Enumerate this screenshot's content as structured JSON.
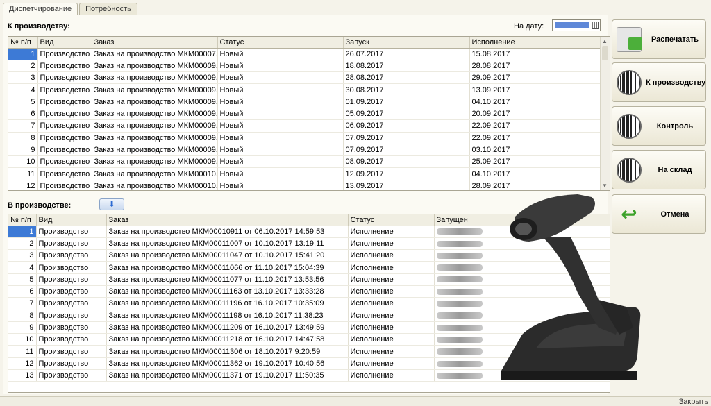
{
  "tabs": [
    {
      "label": "Диспетчирование",
      "active": true
    },
    {
      "label": "Потребность",
      "active": false
    }
  ],
  "top_section": {
    "title": "К производству:",
    "date_label": "На дату:",
    "columns": [
      "№ п/п",
      "Вид",
      "Заказ",
      "Статус",
      "Запуск",
      "Исполнение"
    ],
    "rows": [
      [
        "1",
        "Производство",
        "Заказ на производство МКМ00007...",
        "Новый",
        "26.07.2017",
        "15.08.2017"
      ],
      [
        "2",
        "Производство",
        "Заказ на производство МКМ00009...",
        "Новый",
        "18.08.2017",
        "28.08.2017"
      ],
      [
        "3",
        "Производство",
        "Заказ на производство МКМ00009...",
        "Новый",
        "28.08.2017",
        "29.09.2017"
      ],
      [
        "4",
        "Производство",
        "Заказ на производство МКМ00009...",
        "Новый",
        "30.08.2017",
        "13.09.2017"
      ],
      [
        "5",
        "Производство",
        "Заказ на производство МКМ00009...",
        "Новый",
        "01.09.2017",
        "04.10.2017"
      ],
      [
        "6",
        "Производство",
        "Заказ на производство МКМ00009...",
        "Новый",
        "05.09.2017",
        "20.09.2017"
      ],
      [
        "7",
        "Производство",
        "Заказ на производство МКМ00009...",
        "Новый",
        "06.09.2017",
        "22.09.2017"
      ],
      [
        "8",
        "Производство",
        "Заказ на производство МКМ00009...",
        "Новый",
        "07.09.2017",
        "22.09.2017"
      ],
      [
        "9",
        "Производство",
        "Заказ на производство МКМ00009...",
        "Новый",
        "07.09.2017",
        "03.10.2017"
      ],
      [
        "10",
        "Производство",
        "Заказ на производство МКМ00009...",
        "Новый",
        "08.09.2017",
        "25.09.2017"
      ],
      [
        "11",
        "Производство",
        "Заказ на производство МКМ00010...",
        "Новый",
        "12.09.2017",
        "04.10.2017"
      ],
      [
        "12",
        "Производство",
        "Заказ на производство МКМ00010...",
        "Новый",
        "13.09.2017",
        "28.09.2017"
      ]
    ]
  },
  "bottom_section": {
    "title": "В производстве:",
    "columns": [
      "№ п/п",
      "Вид",
      "Заказ",
      "Статус",
      "Запущен"
    ],
    "rows": [
      [
        "1",
        "Производство",
        "Заказ на производство МКМ00010911 от 06.10.2017 14:59:53",
        "Исполнение"
      ],
      [
        "2",
        "Производство",
        "Заказ на производство МКМ00011007 от 10.10.2017 13:19:11",
        "Исполнение"
      ],
      [
        "3",
        "Производство",
        "Заказ на производство МКМ00011047 от 10.10.2017 15:41:20",
        "Исполнение"
      ],
      [
        "4",
        "Производство",
        "Заказ на производство МКМ00011066 от 11.10.2017 15:04:39",
        "Исполнение"
      ],
      [
        "5",
        "Производство",
        "Заказ на производство МКМ00011077 от 11.10.2017 13:53:56",
        "Исполнение"
      ],
      [
        "6",
        "Производство",
        "Заказ на производство МКМ00011163 от 13.10.2017 13:33:28",
        "Исполнение"
      ],
      [
        "7",
        "Производство",
        "Заказ на производство МКМ00011196 от 16.10.2017 10:35:09",
        "Исполнение"
      ],
      [
        "8",
        "Производство",
        "Заказ на производство МКМ00011198 от 16.10.2017 11:38:23",
        "Исполнение"
      ],
      [
        "9",
        "Производство",
        "Заказ на производство МКМ00011209 от 16.10.2017 13:49:59",
        "Исполнение"
      ],
      [
        "10",
        "Производство",
        "Заказ на производство МКМ00011218 от 16.10.2017 14:47:58",
        "Исполнение"
      ],
      [
        "11",
        "Производство",
        "Заказ на производство МКМ00011306 от 18.10.2017 9:20:59",
        "Исполнение"
      ],
      [
        "12",
        "Производство",
        "Заказ на производство МКМ00011362 от 19.10.2017 10:40:56",
        "Исполнение"
      ],
      [
        "13",
        "Производство",
        "Заказ на производство МКМ00011371 от 19.10.2017 11:50:35",
        "Исполнение"
      ]
    ]
  },
  "buttons": {
    "print": "Распечатать",
    "to_production": "К производству",
    "control": "Контроль",
    "to_warehouse": "На склад",
    "cancel": "Отмена"
  },
  "status_bar": {
    "close": "Закрыть"
  },
  "colors": {
    "selection": "#3d7ad6",
    "accent_green": "#3da22a"
  },
  "icons": [
    "printer-icon",
    "barcode-icon",
    "undo-arrow-icon",
    "arrow-down-icon",
    "calendar-icon"
  ]
}
